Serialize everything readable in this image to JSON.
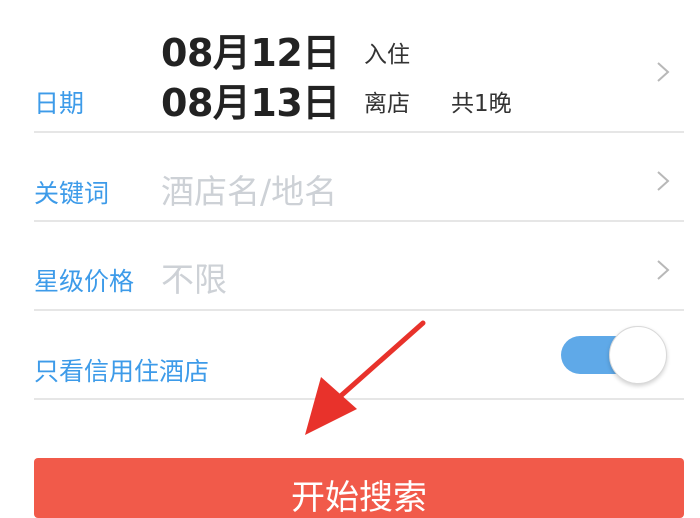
{
  "date_row": {
    "label": "日期",
    "checkin_date": "08月12日",
    "checkin_tag": "入住",
    "checkout_date": "08月13日",
    "checkout_tag": "离店",
    "nights": "共1晚"
  },
  "keyword_row": {
    "label": "关键词",
    "placeholder": "酒店名/地名"
  },
  "star_row": {
    "label": "星级价格",
    "value": "不限"
  },
  "credit_row": {
    "label": "只看信用住酒店",
    "toggle_on": true
  },
  "search_button": {
    "label": "开始搜索"
  },
  "colors": {
    "label_blue": "#3d9be9",
    "toggle_blue": "#5fa9e8",
    "button_red": "#f15a4a",
    "arrow_red": "#e8322b",
    "placeholder_gray": "#cdd1d6"
  },
  "icons": [
    "chevron-right-icon",
    "annotation-arrow"
  ]
}
